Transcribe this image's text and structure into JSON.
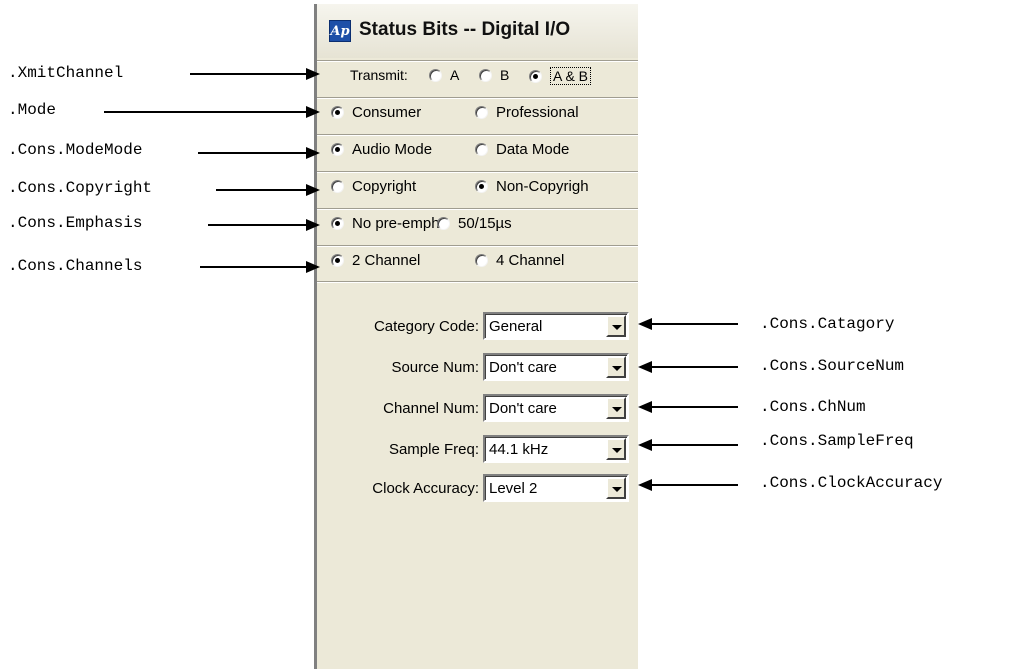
{
  "window": {
    "title": "Status Bits -- Digital I/O",
    "logo_text": "Ap",
    "logo_icon": "audio-precision-logo-icon"
  },
  "xmit": {
    "label": "Transmit:",
    "options": [
      "A",
      "B",
      "A & B"
    ],
    "selected": "A & B"
  },
  "mode": {
    "options": [
      "Consumer",
      "Professional"
    ],
    "selected": "Consumer"
  },
  "mode_mode": {
    "options": [
      "Audio Mode",
      "Data Mode"
    ],
    "selected": "Audio Mode"
  },
  "copyright": {
    "options": [
      "Copyright",
      "Non-Copyrigh"
    ],
    "selected": "Non-Copyrigh"
  },
  "emphasis": {
    "options": [
      "No pre-emph",
      "50/15µs"
    ],
    "selected": "No pre-emph"
  },
  "channels": {
    "options": [
      "2 Channel",
      "4 Channel"
    ],
    "selected": "2 Channel"
  },
  "fields": [
    {
      "label": "Category Code:",
      "value": "General"
    },
    {
      "label": "Source Num:",
      "value": "Don't care"
    },
    {
      "label": "Channel Num:",
      "value": "Don't care"
    },
    {
      "label": "Sample Freq:",
      "value": "44.1 kHz"
    },
    {
      "label": "Clock Accuracy:",
      "value": "Level 2"
    }
  ],
  "annotations_left": [
    ".XmitChannel",
    ".Mode",
    ".Cons.ModeMode",
    ".Cons.Copyright",
    ".Cons.Emphasis",
    ".Cons.Channels"
  ],
  "annotations_right": [
    ".Cons.Catagory",
    ".Cons.SourceNum",
    ".Cons.ChNum",
    ".Cons.SampleFreq",
    ".Cons.ClockAccuracy"
  ]
}
